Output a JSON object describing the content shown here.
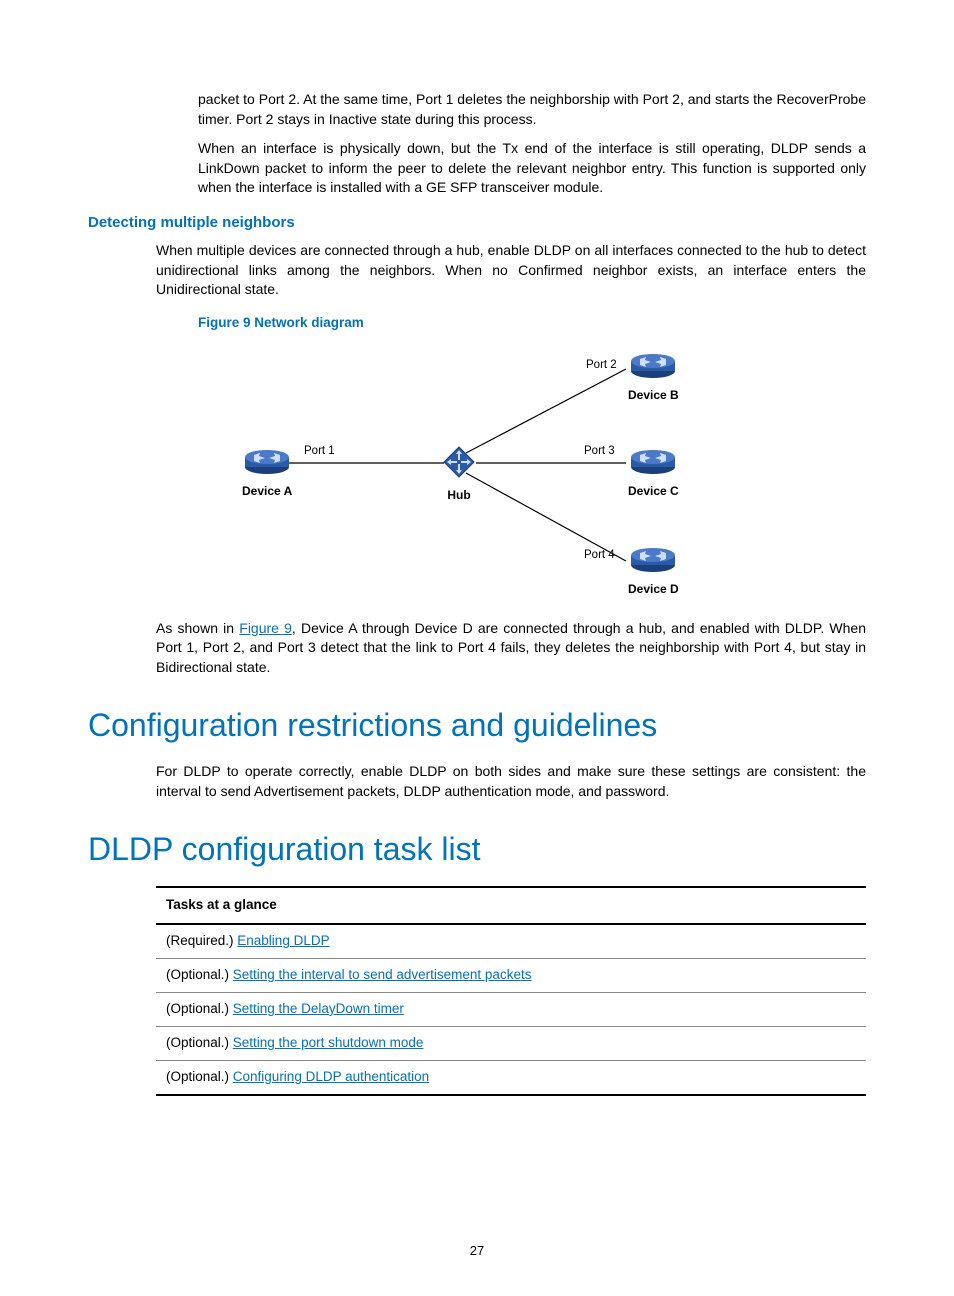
{
  "para1": "packet to Port 2. At the same time, Port 1 deletes the neighborship with Port 2, and starts the RecoverProbe timer. Port 2 stays in Inactive state during this process.",
  "para2": "When an interface is physically down, but the Tx end of the interface is still operating, DLDP sends a LinkDown packet to inform the peer to delete the relevant neighbor entry. This function is supported only when the interface is installed with a GE SFP transceiver module.",
  "h3_detecting": "Detecting multiple neighbors",
  "para3": "When multiple devices are connected through a hub, enable DLDP on all interfaces connected to the hub to detect unidirectional links among the neighbors. When no Confirmed neighbor exists, an interface enters the Unidirectional state.",
  "fig_caption": "Figure 9 Network diagram",
  "diagram": {
    "port1": "Port 1",
    "port2": "Port 2",
    "port3": "Port 3",
    "port4": "Port 4",
    "deviceA": "Device A",
    "deviceB": "Device B",
    "deviceC": "Device C",
    "deviceD": "Device D",
    "hub": "Hub"
  },
  "para4_pre": "As shown in ",
  "para4_link": "Figure 9",
  "para4_post": ", Device A through Device D are connected through a hub, and enabled with DLDP. When Port 1, Port 2, and Port 3 detect that the link to Port 4 fails, they deletes the neighborship with Port 4, but stay in Bidirectional state.",
  "h1_restrictions": "Configuration restrictions and guidelines",
  "para5": "For DLDP to operate correctly, enable DLDP on both sides and make sure these settings are consistent: the interval to send Advertisement packets, DLDP authentication mode, and password.",
  "h1_tasklist": "DLDP configuration task list",
  "table": {
    "header": "Tasks at a glance",
    "rows": [
      {
        "prefix": "(Required.) ",
        "link": "Enabling DLDP"
      },
      {
        "prefix": "(Optional.) ",
        "link": "Setting the interval to send advertisement packets"
      },
      {
        "prefix": "(Optional.) ",
        "link": "Setting the DelayDown timer"
      },
      {
        "prefix": "(Optional.) ",
        "link": "Setting the port shutdown mode"
      },
      {
        "prefix": "(Optional.) ",
        "link": "Configuring DLDP authentication"
      }
    ]
  },
  "page_number": "27"
}
